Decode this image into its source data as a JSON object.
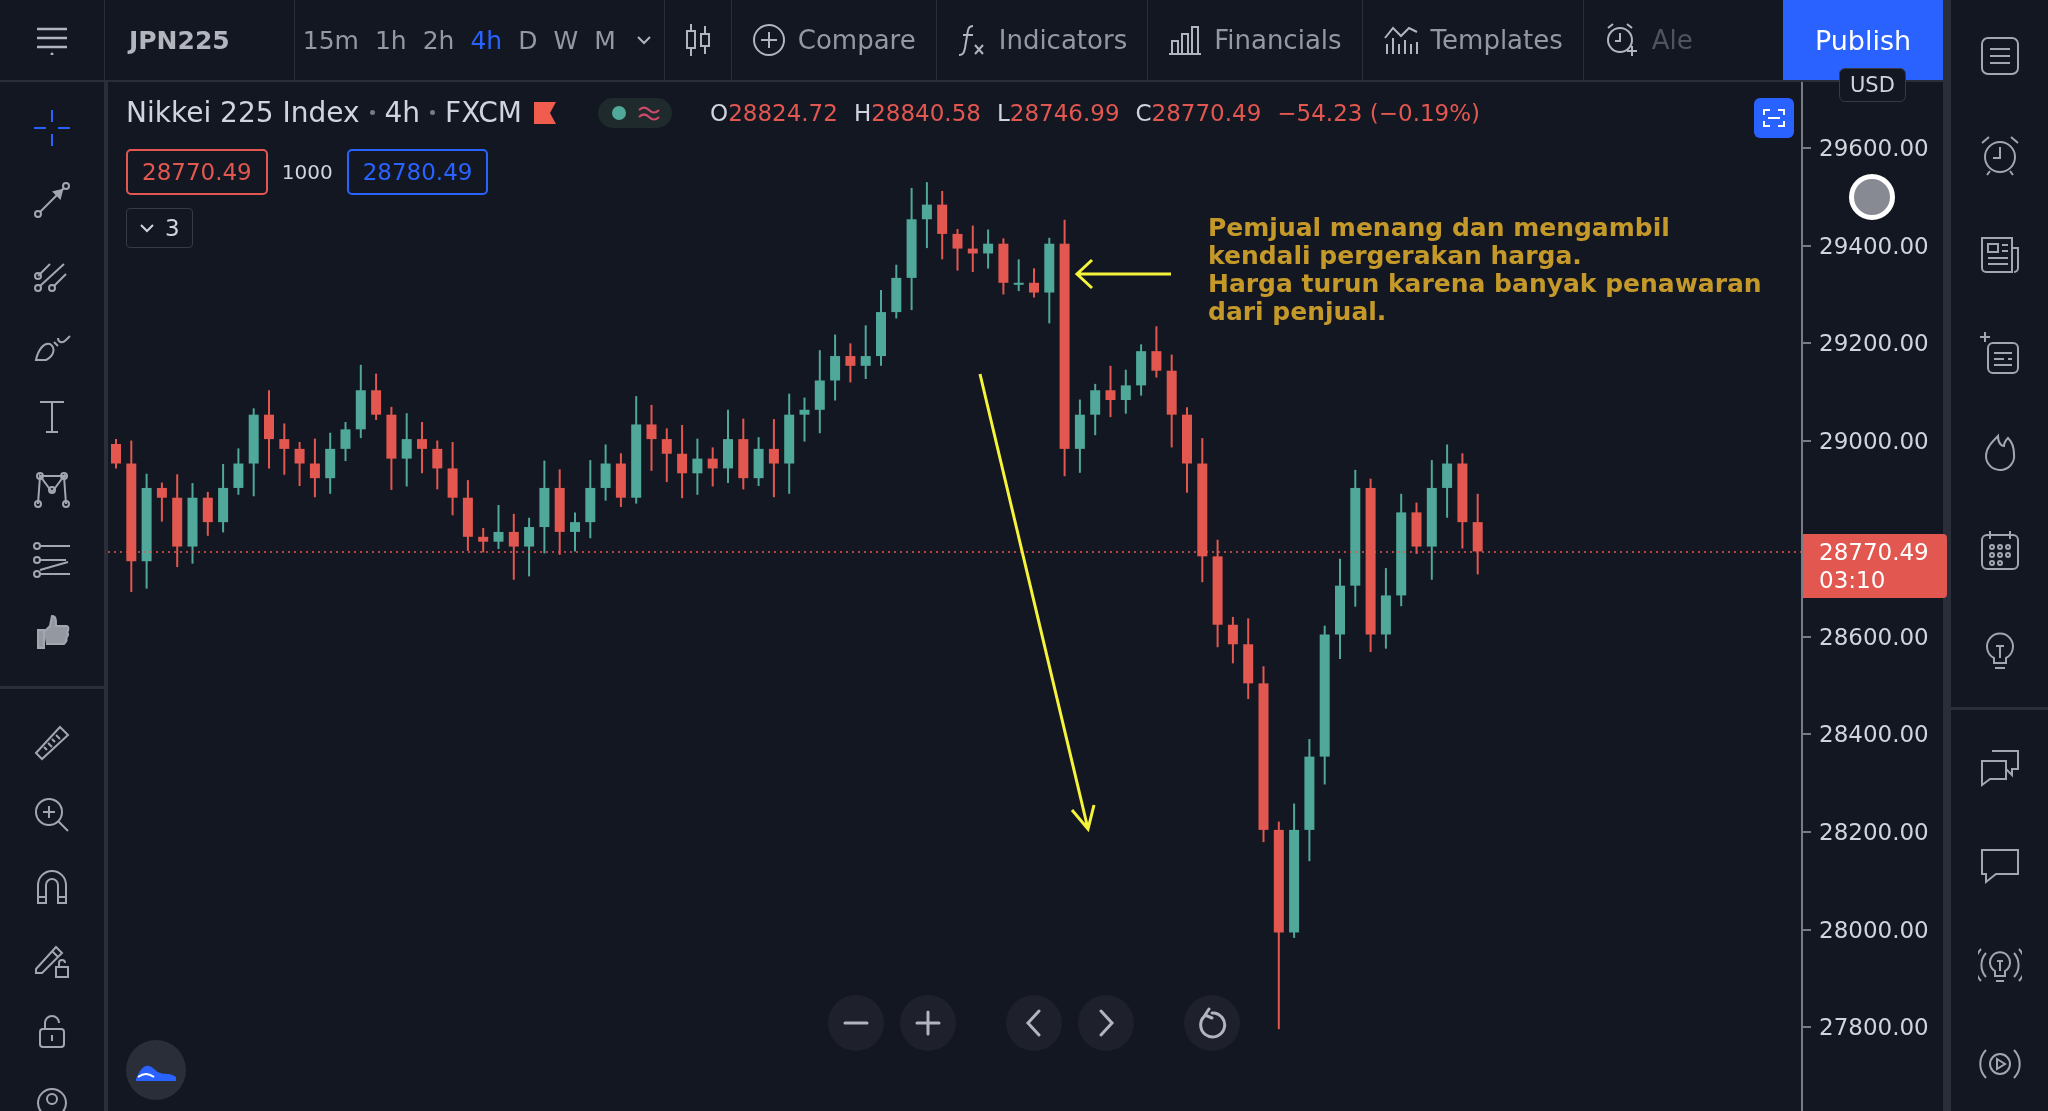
{
  "toolbar": {
    "symbol": "JPN225",
    "intervals": [
      {
        "label": "15m",
        "selected": false
      },
      {
        "label": "1h",
        "selected": false
      },
      {
        "label": "2h",
        "selected": false
      },
      {
        "label": "4h",
        "selected": true
      },
      {
        "label": "D",
        "selected": false
      },
      {
        "label": "W",
        "selected": false
      },
      {
        "label": "M",
        "selected": false
      }
    ],
    "buttons": [
      {
        "kind": "compare",
        "label": "Compare"
      },
      {
        "kind": "indicators",
        "label": "Indicators"
      },
      {
        "kind": "financials",
        "label": "Financials"
      },
      {
        "kind": "templates",
        "label": "Templates"
      },
      {
        "kind": "alert",
        "label": "Ale"
      }
    ],
    "publish": "Publish"
  },
  "legend": {
    "title": "Nikkei 225 Index",
    "interval": "4h",
    "exchange": "FXCM",
    "ohlc": [
      {
        "key": "O",
        "value": "28824.72"
      },
      {
        "key": "H",
        "value": "28840.58"
      },
      {
        "key": "L",
        "value": "28746.99"
      },
      {
        "key": "C",
        "value": "28770.49"
      }
    ],
    "change": "−54.23 (−0.19%)"
  },
  "trade": {
    "sell": "28770.49",
    "spread": "1000",
    "buy": "28780.49"
  },
  "indicators_toggle": {
    "count": "3"
  },
  "annotation": {
    "lines": [
      "Pemjual menang dan mengambil",
      "kendali pergerakan harga.",
      "Harga turun karena banyak penawaran",
      "dari penjual."
    ]
  },
  "price_axis": {
    "currency": "USD",
    "ticks": [
      "29600.00",
      "29400.00",
      "29200.00",
      "29000.00",
      "28600.00",
      "28400.00",
      "28200.00",
      "28000.00",
      "27800.00"
    ],
    "last_price": "28770.49",
    "countdown": "03:10"
  }
}
